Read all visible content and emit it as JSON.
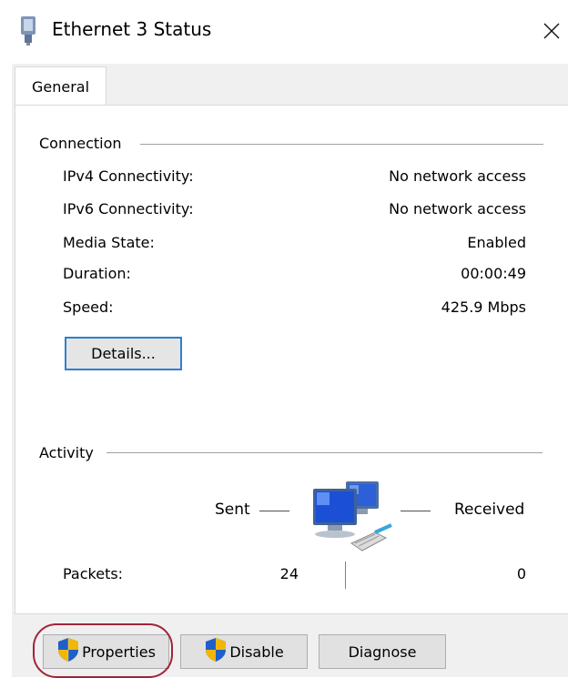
{
  "window": {
    "title": "Ethernet 3 Status",
    "icons": {
      "app": "network-adapter-icon",
      "close": "close-icon"
    }
  },
  "tabs": [
    {
      "label": "General",
      "active": true
    }
  ],
  "connection": {
    "heading": "Connection",
    "rows": [
      {
        "label": "IPv4 Connectivity:",
        "value": "No network access"
      },
      {
        "label": "IPv6 Connectivity:",
        "value": "No network access"
      },
      {
        "label": "Media State:",
        "value": "Enabled"
      },
      {
        "label": "Duration:",
        "value": "00:00:49"
      },
      {
        "label": "Speed:",
        "value": "425.9 Mbps"
      }
    ],
    "details_label": "Details..."
  },
  "activity": {
    "heading": "Activity",
    "sent_label": "Sent",
    "received_label": "Received",
    "packets_label": "Packets:",
    "packets_sent": "24",
    "packets_received": "0",
    "icon": "network-computers-icon"
  },
  "buttons": {
    "properties": "Properties",
    "disable": "Disable",
    "diagnose": "Diagnose",
    "shield_icon": "uac-shield-icon"
  },
  "colors": {
    "focus_border": "#2d7fd1",
    "highlight_ring": "#a0243a",
    "panel_background": "#f0f0f0"
  }
}
